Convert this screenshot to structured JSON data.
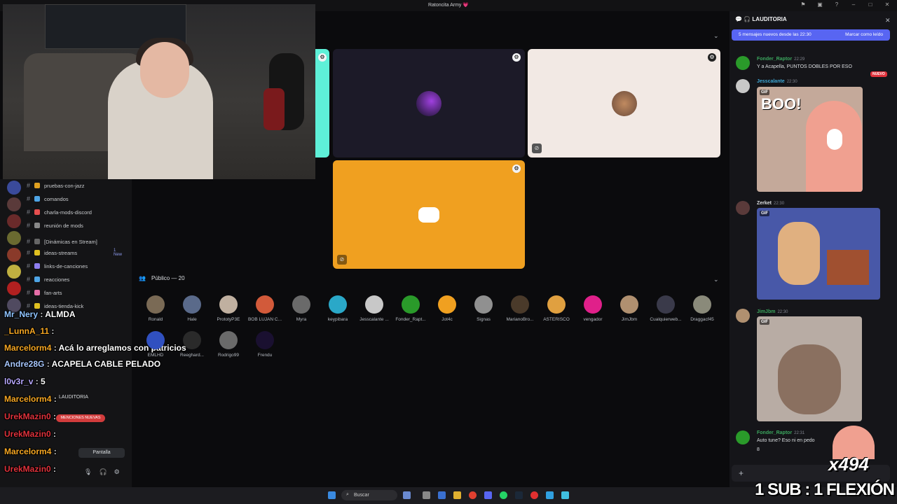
{
  "window": {
    "title": "Ratoncita Army 💗"
  },
  "sidebar": {
    "channels": [
      {
        "label": "pruebas-con-jazz",
        "color": "#e0a020"
      },
      {
        "label": "comandos",
        "color": "#4ea5e6"
      },
      {
        "label": "charla-mods-discord",
        "color": "#e64e4e"
      },
      {
        "label": "reunión de mods",
        "color": "#888888"
      },
      {
        "label": "[Dinámicas en Stream]",
        "color": "#666666"
      },
      {
        "label": "ideas-streams",
        "color": "#e0c020",
        "badge": "1 New"
      },
      {
        "label": "links-de-canciones",
        "color": "#8e7ef0"
      },
      {
        "label": "reacciones",
        "color": "#4ea5e6"
      },
      {
        "label": "fan-arts",
        "color": "#e66ea8"
      },
      {
        "label": "ideas-tienda-kick",
        "color": "#e0c020"
      }
    ],
    "voice": {
      "channel": "LAUDITORIA",
      "mentions": "MENCIONES NUEVAS",
      "screen_label": "Pantalla"
    }
  },
  "chat_overlay": [
    {
      "user": "Mr_Nery",
      "text": "ALMDA",
      "color": "#8fc4ff"
    },
    {
      "user": "_LunnA_11",
      "text": "",
      "color": "#f5a623"
    },
    {
      "user": "Marcelorm4",
      "text": "Acá lo arreglamos con patricios",
      "color": "#f5a623"
    },
    {
      "user": "Andre28G",
      "text": "ACAPELA CABLE PELADO",
      "color": "#a8c8ff"
    },
    {
      "user": "l0v3r_v",
      "text": "5",
      "color": "#b8a8ff"
    },
    {
      "user": "Marcelorm4",
      "text": "",
      "color": "#f5a623"
    },
    {
      "user": "UrekMazin0",
      "text": "",
      "color": "#e0323c"
    },
    {
      "user": "UrekMazin0",
      "text": "",
      "color": "#e0323c"
    },
    {
      "user": "Marcelorm4",
      "text": "",
      "color": "#f5a623"
    },
    {
      "user": "UrekMazin0",
      "text": "",
      "color": "#e0323c"
    }
  ],
  "stage": {
    "audience_label": "Público — 20",
    "audience": [
      {
        "name": "Ronald",
        "color": "#7a6a55"
      },
      {
        "name": "Hale",
        "color": "#5a6a8a"
      },
      {
        "name": "PrototyP3E",
        "color": "#c0b0a0"
      },
      {
        "name": "BOB LUJAN C...",
        "color": "#d25a3a"
      },
      {
        "name": "Myra",
        "color": "#6a6a6a"
      },
      {
        "name": "keypibara",
        "color": "#2aa8c8"
      },
      {
        "name": "Jesscalante ...",
        "color": "#c8c8c8"
      },
      {
        "name": "Fonder_Rapt...",
        "color": "#2a9a2a"
      },
      {
        "name": "Jot4c",
        "color": "#f0a020"
      },
      {
        "name": "Signas",
        "color": "#909090"
      },
      {
        "name": "MarianoBro...",
        "color": "#4a3a2a"
      },
      {
        "name": "ASTERISCO",
        "color": "#e0a040"
      },
      {
        "name": "vengador",
        "color": "#e0208a"
      },
      {
        "name": "JimJbm",
        "color": "#b09070"
      },
      {
        "name": "Cualquierweb...",
        "color": "#3a3a4a"
      },
      {
        "name": "Draggacf45",
        "color": "#8a8a7a"
      },
      {
        "name": "EMLHD",
        "color": "#3050c0"
      },
      {
        "name": "Reeghard...",
        "color": "#2a2a2a"
      },
      {
        "name": "Rodrigo99",
        "color": "#6a6a6a"
      },
      {
        "name": "Frendu",
        "color": "#1a1030"
      }
    ]
  },
  "right_panel": {
    "header": "LAUDITORIA",
    "banner_text": "5 mensajes nuevos desde las 22:30",
    "banner_action": "Marcar como leído",
    "new_badge": "NUEVO",
    "messages": [
      {
        "author": "Fonder_Raptor",
        "time": "22:29",
        "text": "Y a Acapella, PUNTOS DOBLES POR ESO",
        "color": "#3ba55d"
      },
      {
        "author": "Jesscalante",
        "time": "22:30",
        "text": "",
        "color": "#3ea8d6",
        "gif": "BOO!"
      },
      {
        "author": "Zerket",
        "time": "22:30",
        "text": "",
        "color": "#dbdee1"
      },
      {
        "author": "JimJbm",
        "time": "22:30",
        "text": "",
        "color": "#3ba55d"
      },
      {
        "author": "Fonder_Raptor",
        "time": "22:31",
        "text": "Auto tune? Eso ni en pedo",
        "text2": "8",
        "color": "#3ba55d"
      }
    ],
    "gif_label": "GIF"
  },
  "taskbar": {
    "search": "Buscar"
  },
  "overlays": {
    "counter": "x494",
    "sub_goal": "1 SUB : 1 FLEXIÓN"
  }
}
